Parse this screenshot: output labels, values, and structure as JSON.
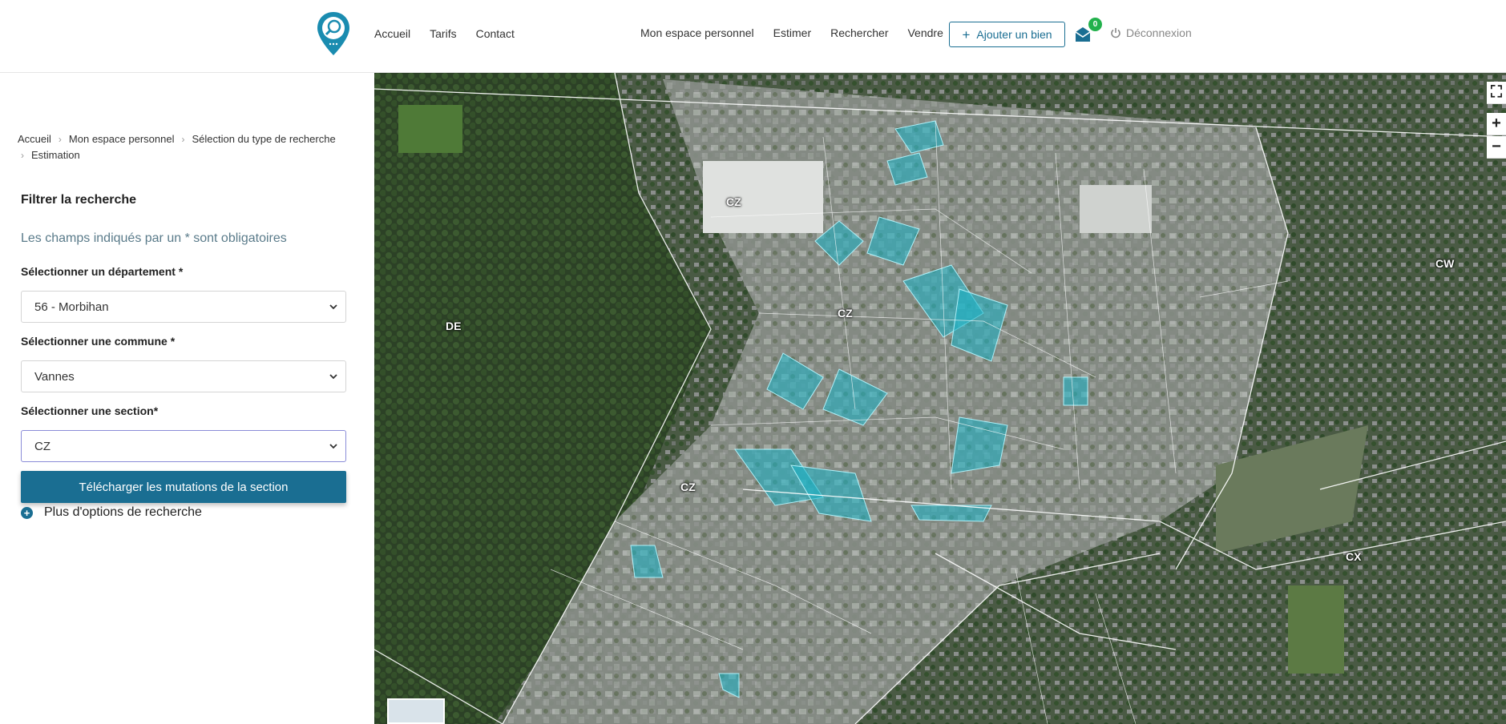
{
  "header": {
    "logo_icon": "location-pin-search-icon",
    "nav_left": [
      "Accueil",
      "Tarifs",
      "Contact"
    ],
    "nav_right": [
      "Mon espace personnel",
      "Estimer",
      "Rechercher",
      "Vendre"
    ],
    "add_button_label": "Ajouter un bien",
    "mail_badge_count": "0",
    "logout_label": "Déconnexion"
  },
  "sidebar": {
    "breadcrumb": [
      "Accueil",
      "Mon espace personnel",
      "Sélection du type de recherche",
      "Estimation"
    ],
    "filter_title": "Filtrer la recherche",
    "required_note": "Les champs indiqués par un * sont obligatoires",
    "department": {
      "label": "Sélectionner un département *",
      "value": "56 - Morbihan"
    },
    "commune": {
      "label": "Sélectionner une commune *",
      "value": "Vannes"
    },
    "section": {
      "label": "Sélectionner une section*",
      "value": "CZ"
    },
    "download_button": "Télécharger les mutations de la section",
    "more_options": "Plus d'options de recherche"
  },
  "map": {
    "section_labels": [
      "CZ",
      "CZ",
      "CZ",
      "DE",
      "CW",
      "CX"
    ],
    "controls": {
      "fullscreen": "⛶",
      "zoom_in": "+",
      "zoom_out": "−"
    }
  },
  "colors": {
    "primary": "#1a6e92",
    "badge": "#22b14c",
    "parcel_highlight": "#19b5c8"
  }
}
